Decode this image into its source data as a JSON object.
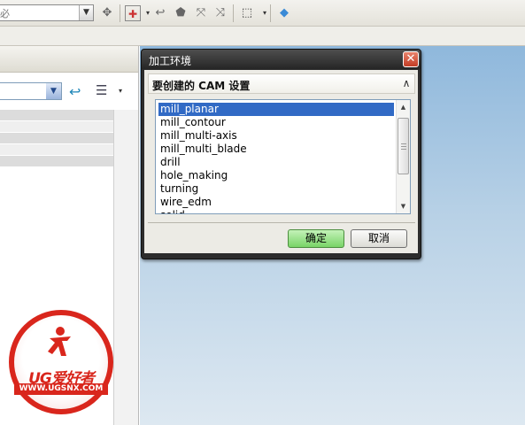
{
  "toolbar": {
    "combo_partial": "必",
    "icons": [
      "pattern-icon",
      "point-icon",
      "arc-icon",
      "solid-icon",
      "coordinate-icon",
      "move-icon",
      "select-box-icon",
      "view-cube-icon"
    ]
  },
  "left_panel": {
    "combo_value": "",
    "back_icon": "back-arrow-icon",
    "list_icon": "list-view-icon"
  },
  "dialog": {
    "title": "加工环境",
    "close_glyph": "✕",
    "section_title": "要创建的 CAM 设置",
    "collapse_glyph": "∧",
    "items": [
      "mill_planar",
      "mill_contour",
      "mill_multi-axis",
      "mill_multi_blade",
      "drill",
      "hole_making",
      "turning",
      "wire_edm",
      "solid"
    ],
    "selected_index": 0,
    "ok_label": "确定",
    "cancel_label": "取消"
  },
  "watermark": {
    "brand": "UG爱好者",
    "url": "WWW.UGSNX.COM"
  },
  "colors": {
    "selection": "#316ac5",
    "ok_button": "#79d467",
    "dialog_frame": "#2c2c2c",
    "watermark_red": "#d9261c"
  }
}
